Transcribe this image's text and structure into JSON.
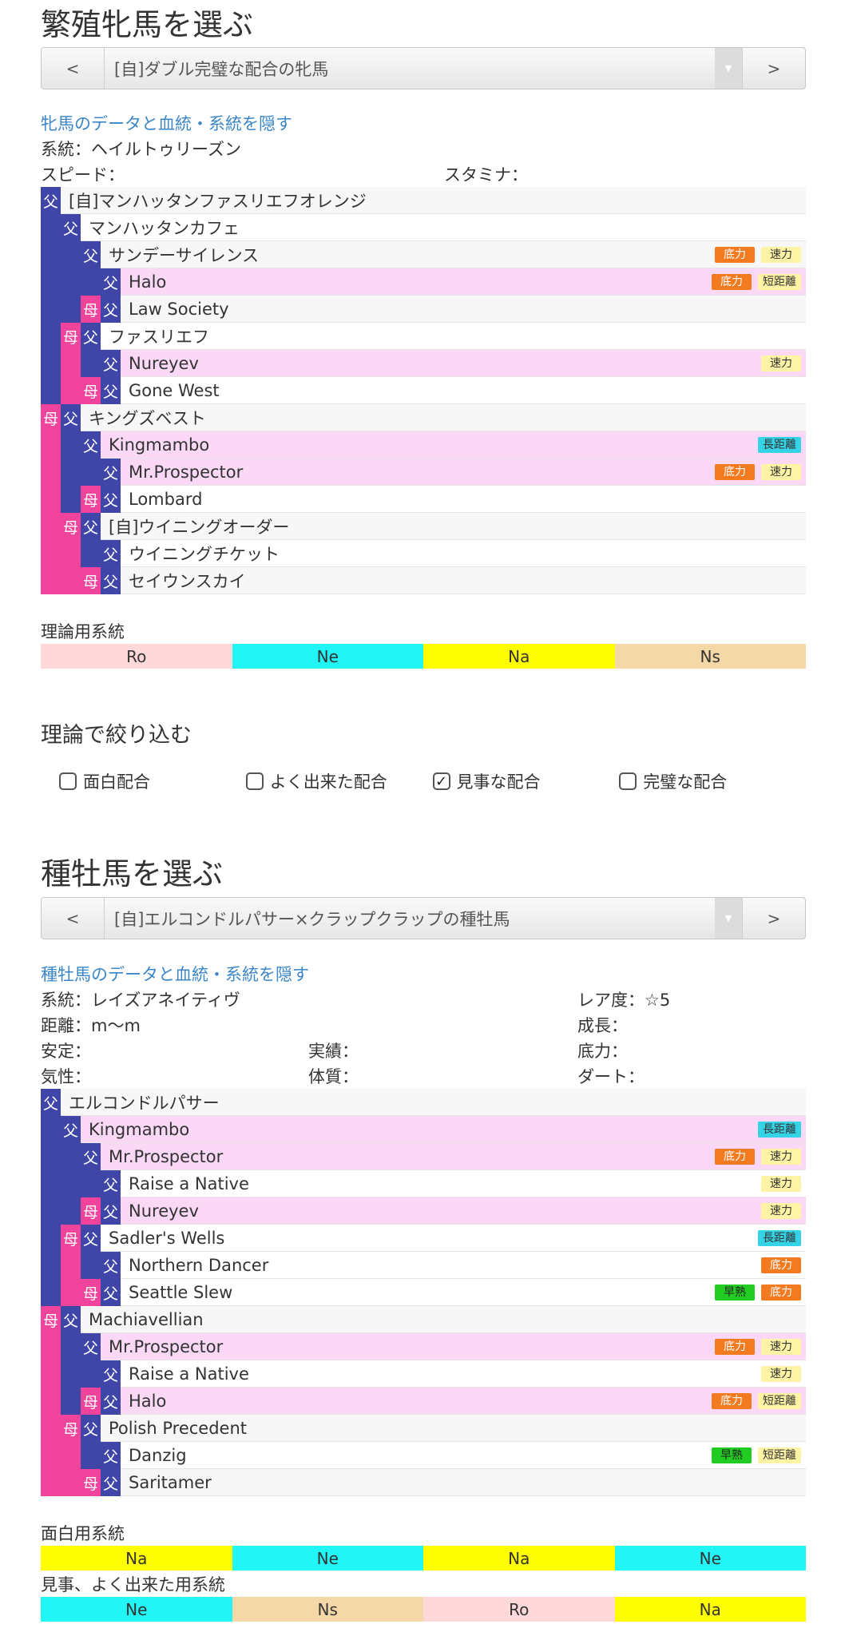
{
  "mare": {
    "title": "繁殖牝馬を選ぶ",
    "prev": "<",
    "next": ">",
    "selected": "[自]ダブル完璧な配合の牝馬",
    "hide_link": "牝馬のデータと血統・系統を隠す",
    "lineage": "系統：ヘイルトゥリーズン",
    "speed": "スピード：",
    "stamina": "スタミナ：",
    "pedigree": [
      {
        "marks": [
          "f"
        ],
        "name": "[自]マンハッタンファスリエフオレンジ",
        "bg": "alt",
        "tags": []
      },
      {
        "marks": [
          "bf",
          "f"
        ],
        "name": "マンハッタンカフェ",
        "bg": "white",
        "tags": []
      },
      {
        "marks": [
          "bf",
          "bf",
          "f"
        ],
        "name": "サンデーサイレンス",
        "bg": "alt",
        "tags": [
          {
            "t": "底力",
            "c": "orange"
          },
          {
            "t": "速力",
            "c": "yellow"
          }
        ]
      },
      {
        "marks": [
          "bf",
          "bf",
          "bf",
          "f"
        ],
        "name": "Halo",
        "bg": "pink",
        "tags": [
          {
            "t": "底力",
            "c": "orange"
          },
          {
            "t": "短距離",
            "c": "yellow"
          }
        ]
      },
      {
        "marks": [
          "bf",
          "bf",
          "m",
          "f"
        ],
        "name": "Law Society",
        "bg": "alt",
        "tags": []
      },
      {
        "marks": [
          "bf",
          "m",
          "f"
        ],
        "name": "ファスリエフ",
        "bg": "white",
        "tags": []
      },
      {
        "marks": [
          "bf",
          "bm",
          "bf",
          "f"
        ],
        "name": "Nureyev",
        "bg": "pink",
        "tags": [
          {
            "t": "速力",
            "c": "yellow"
          }
        ]
      },
      {
        "marks": [
          "bf",
          "bm",
          "m",
          "f"
        ],
        "name": "Gone West",
        "bg": "white",
        "tags": []
      },
      {
        "marks": [
          "m",
          "f"
        ],
        "name": "キングズベスト",
        "bg": "alt",
        "tags": []
      },
      {
        "marks": [
          "bm",
          "bf",
          "f"
        ],
        "name": "Kingmambo",
        "bg": "pink",
        "tags": [
          {
            "t": "長距離",
            "c": "cyan"
          }
        ]
      },
      {
        "marks": [
          "bm",
          "bf",
          "bf",
          "f"
        ],
        "name": "Mr.Prospector",
        "bg": "pink",
        "tags": [
          {
            "t": "底力",
            "c": "orange"
          },
          {
            "t": "速力",
            "c": "yellow"
          }
        ]
      },
      {
        "marks": [
          "bm",
          "bf",
          "m",
          "f"
        ],
        "name": "Lombard",
        "bg": "white",
        "tags": []
      },
      {
        "marks": [
          "bm",
          "m",
          "f"
        ],
        "name": "[自]ウイニングオーダー",
        "bg": "alt",
        "tags": []
      },
      {
        "marks": [
          "bm",
          "bm",
          "bf",
          "f"
        ],
        "name": "ウイニングチケット",
        "bg": "white",
        "tags": []
      },
      {
        "marks": [
          "bm",
          "bm",
          "m",
          "f"
        ],
        "name": "セイウンスカイ",
        "bg": "alt",
        "tags": []
      }
    ],
    "theory_label": "理論用系統",
    "theory_bar": [
      {
        "t": "Ro",
        "c": "#ffd9d9"
      },
      {
        "t": "Ne",
        "c": "#22f5f5"
      },
      {
        "t": "Na",
        "c": "#ffff00"
      },
      {
        "t": "Ns",
        "c": "#f5d8a8"
      }
    ]
  },
  "filter": {
    "title": "理論で絞り込む",
    "options": [
      {
        "label": "面白配合",
        "checked": false
      },
      {
        "label": "よく出来た配合",
        "checked": false
      },
      {
        "label": "見事な配合",
        "checked": true
      },
      {
        "label": "完璧な配合",
        "checked": false
      }
    ]
  },
  "stallion": {
    "title": "種牡馬を選ぶ",
    "prev": "<",
    "next": ">",
    "selected": "[自]エルコンドルパサー×クラップクラップの種牡馬",
    "hide_link": "種牡馬のデータと血統・系統を隠す",
    "lineage": "系統：レイズアネイティヴ",
    "rarity": "レア度：☆5",
    "distance": "距離：m〜m",
    "growth": "成長：",
    "stability": "安定：",
    "record": "実績：",
    "power": "底力：",
    "temper": "気性：",
    "constitution": "体質：",
    "dirt": "ダート：",
    "pedigree": [
      {
        "marks": [
          "f"
        ],
        "name": "エルコンドルパサー",
        "bg": "alt",
        "tags": []
      },
      {
        "marks": [
          "bf",
          "f"
        ],
        "name": "Kingmambo",
        "bg": "pink",
        "tags": [
          {
            "t": "長距離",
            "c": "cyan"
          }
        ]
      },
      {
        "marks": [
          "bf",
          "bf",
          "f"
        ],
        "name": "Mr.Prospector",
        "bg": "pink",
        "tags": [
          {
            "t": "底力",
            "c": "orange"
          },
          {
            "t": "速力",
            "c": "yellow"
          }
        ]
      },
      {
        "marks": [
          "bf",
          "bf",
          "bf",
          "f"
        ],
        "name": "Raise a Native",
        "bg": "white",
        "tags": [
          {
            "t": "速力",
            "c": "yellow"
          }
        ]
      },
      {
        "marks": [
          "bf",
          "bf",
          "m",
          "f"
        ],
        "name": "Nureyev",
        "bg": "pink",
        "tags": [
          {
            "t": "速力",
            "c": "yellow"
          }
        ]
      },
      {
        "marks": [
          "bf",
          "m",
          "f"
        ],
        "name": "Sadler's Wells",
        "bg": "white",
        "tags": [
          {
            "t": "長距離",
            "c": "cyan"
          }
        ]
      },
      {
        "marks": [
          "bf",
          "bm",
          "bf",
          "f"
        ],
        "name": "Northern Dancer",
        "bg": "white",
        "tags": [
          {
            "t": "底力",
            "c": "orange"
          }
        ]
      },
      {
        "marks": [
          "bf",
          "bm",
          "m",
          "f"
        ],
        "name": "Seattle Slew",
        "bg": "white",
        "tags": [
          {
            "t": "早熟",
            "c": "green"
          },
          {
            "t": "底力",
            "c": "orange"
          }
        ]
      },
      {
        "marks": [
          "m",
          "f"
        ],
        "name": "Machiavellian",
        "bg": "alt",
        "tags": []
      },
      {
        "marks": [
          "bm",
          "bf",
          "f"
        ],
        "name": "Mr.Prospector",
        "bg": "pink",
        "tags": [
          {
            "t": "底力",
            "c": "orange"
          },
          {
            "t": "速力",
            "c": "yellow"
          }
        ]
      },
      {
        "marks": [
          "bm",
          "bf",
          "bf",
          "f"
        ],
        "name": "Raise a Native",
        "bg": "white",
        "tags": [
          {
            "t": "速力",
            "c": "yellow"
          }
        ]
      },
      {
        "marks": [
          "bm",
          "bf",
          "m",
          "f"
        ],
        "name": "Halo",
        "bg": "pink",
        "tags": [
          {
            "t": "底力",
            "c": "orange"
          },
          {
            "t": "短距離",
            "c": "yellow"
          }
        ]
      },
      {
        "marks": [
          "bm",
          "m",
          "f"
        ],
        "name": "Polish Precedent",
        "bg": "alt",
        "tags": []
      },
      {
        "marks": [
          "bm",
          "bm",
          "bf",
          "f"
        ],
        "name": "Danzig",
        "bg": "white",
        "tags": [
          {
            "t": "早熟",
            "c": "green"
          },
          {
            "t": "短距離",
            "c": "yellow"
          }
        ]
      },
      {
        "marks": [
          "bm",
          "bm",
          "m",
          "f"
        ],
        "name": "Saritamer",
        "bg": "alt",
        "tags": []
      }
    ],
    "fun_label": "面白用系統",
    "fun_bar": [
      {
        "t": "Na",
        "c": "#ffff00"
      },
      {
        "t": "Ne",
        "c": "#22f5f5"
      },
      {
        "t": "Na",
        "c": "#ffff00"
      },
      {
        "t": "Ne",
        "c": "#22f5f5"
      }
    ],
    "good_label": "見事、よく出来た用系統",
    "good_bar": [
      {
        "t": "Ne",
        "c": "#22f5f5"
      },
      {
        "t": "Ns",
        "c": "#f5d8a8"
      },
      {
        "t": "Ro",
        "c": "#ffd9d9"
      },
      {
        "t": "Na",
        "c": "#ffff00"
      }
    ]
  },
  "marks": {
    "f": "父",
    "m": "母"
  }
}
